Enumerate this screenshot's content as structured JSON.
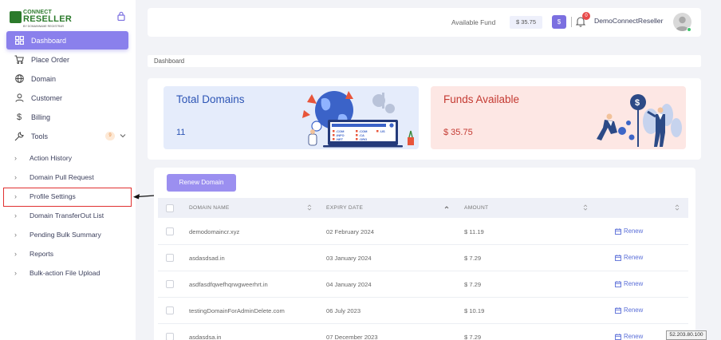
{
  "logo": {
    "line1": "CONNECT",
    "line2": "RESELLER",
    "line3": "BY DOMAINNAME REGISTRAR"
  },
  "sidebar": {
    "items": [
      {
        "label": "Dashboard",
        "icon": "grid-icon",
        "active": true
      },
      {
        "label": "Place Order",
        "icon": "cart-icon"
      },
      {
        "label": "Domain",
        "icon": "globe-icon"
      },
      {
        "label": "Customer",
        "icon": "user-icon"
      },
      {
        "label": "Billing",
        "icon": "dollar-icon"
      },
      {
        "label": "Tools",
        "icon": "wrench-icon",
        "badge": "9"
      }
    ],
    "sub_items": [
      {
        "label": "Action History"
      },
      {
        "label": "Domain Pull Request"
      },
      {
        "label": "Profile Settings"
      },
      {
        "label": "Domain TransferOut List"
      },
      {
        "label": "Pending Bulk Summary"
      },
      {
        "label": "Reports"
      },
      {
        "label": "Bulk-action File Upload"
      }
    ]
  },
  "topbar": {
    "fund_label": "Available Fund",
    "fund_value": "$ 35.75",
    "dollar_button": "$",
    "notification_count": "0",
    "username": "DemoConnectReseller"
  },
  "breadcrumb": "Dashboard",
  "stats": {
    "total_domains": {
      "title": "Total Domains",
      "value": "11"
    },
    "funds_available": {
      "title": "Funds Available",
      "value": "$ 35.75"
    }
  },
  "illustration_labels": [
    ".COM",
    ".COM",
    ".US",
    ".INFO",
    ".CA",
    ".NET",
    ".ORG"
  ],
  "table": {
    "renew_domain_button": "Renew Domain",
    "headers": {
      "domain_name": "DOMAIN NAME",
      "expiry_date": "EXPIRY DATE",
      "amount": "AMOUNT"
    },
    "renew_label": "Renew",
    "rows": [
      {
        "domain": "demodomaincr.xyz",
        "expiry": "02 February 2024",
        "amount": "$ 11.19"
      },
      {
        "domain": "asdasdsad.in",
        "expiry": "03 January 2024",
        "amount": "$ 7.29"
      },
      {
        "domain": "asdfasdfqwefhqrwgweerhrt.in",
        "expiry": "04 January 2024",
        "amount": "$ 7.29"
      },
      {
        "domain": "testingDomainForAdminDelete.com",
        "expiry": "06 July 2023",
        "amount": "$ 10.19"
      },
      {
        "domain": "asdasdsa.in",
        "expiry": "07 December 2023",
        "amount": "$ 7.29"
      }
    ]
  },
  "ip_tag": "52.203.80.100",
  "colors": {
    "accent": "#8a80ec",
    "blue_card": "#e5ecfb",
    "pink_card": "#fde7e4",
    "highlight": "#e03030"
  }
}
